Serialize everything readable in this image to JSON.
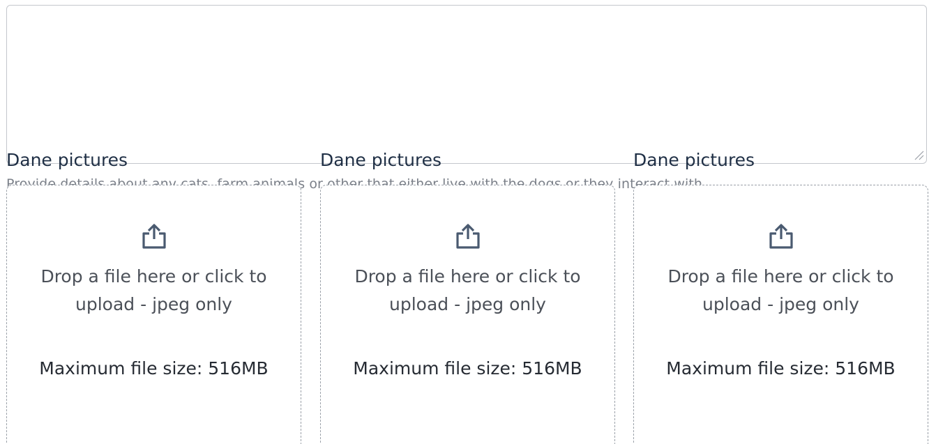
{
  "description_field": {
    "value": "",
    "helper_text": "Provide details about any cats, farm animals or other that either live with the dogs or they interact with"
  },
  "upload_fields": [
    {
      "label": "Dane pictures",
      "prompt": "Drop a file here or click to upload - jpeg only",
      "max_size": "Maximum file size: 516MB"
    },
    {
      "label": "Dane pictures",
      "prompt": "Drop a file here or click to upload - jpeg only",
      "max_size": "Maximum file size: 516MB"
    },
    {
      "label": "Dane pictures",
      "prompt": "Drop a file here or click to upload - jpeg only",
      "max_size": "Maximum file size: 516MB"
    }
  ],
  "icons": {
    "upload": "upload-icon",
    "resize": "resize-grip-icon"
  },
  "colors": {
    "label": "#1f2f45",
    "helper": "#7b8089",
    "dropzone_border": "#9aa0a8",
    "dropzone_text": "#4b5058",
    "icon": "#4a5a70"
  }
}
